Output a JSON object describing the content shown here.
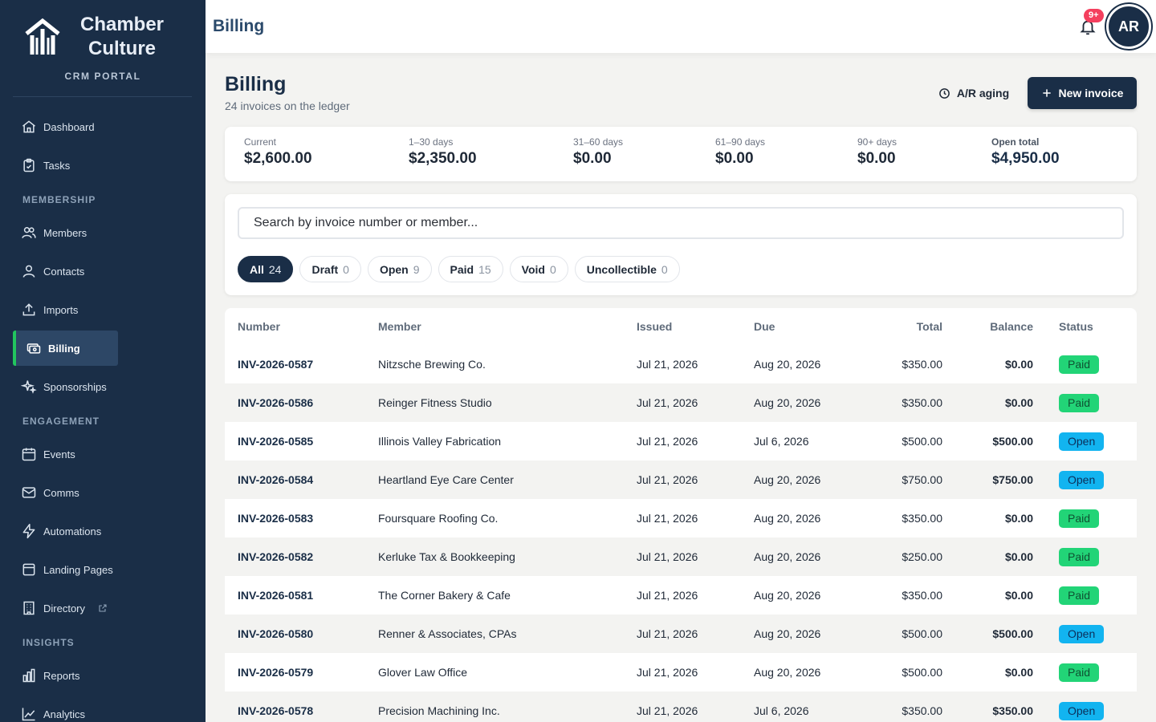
{
  "brand": {
    "name": "Chamber Culture",
    "subtitle": "CRM PORTAL"
  },
  "sidebar": {
    "items": [
      {
        "label": "Dashboard",
        "icon": "home-icon"
      },
      {
        "label": "Tasks",
        "icon": "clipboard-icon"
      },
      {
        "label": "Members",
        "icon": "users-icon"
      },
      {
        "label": "Contacts",
        "icon": "user-icon"
      },
      {
        "label": "Imports",
        "icon": "upload-icon"
      },
      {
        "label": "Billing",
        "icon": "cash-icon",
        "active": true
      },
      {
        "label": "Sponsorships",
        "icon": "sparkles-icon"
      },
      {
        "label": "Events",
        "icon": "calendar-icon"
      },
      {
        "label": "Comms",
        "icon": "mail-icon"
      },
      {
        "label": "Automations",
        "icon": "bolt-icon"
      },
      {
        "label": "Landing Pages",
        "icon": "window-icon"
      },
      {
        "label": "Directory",
        "icon": "building-icon",
        "external": true
      },
      {
        "label": "Reports",
        "icon": "bar-chart-icon"
      },
      {
        "label": "Analytics",
        "icon": "trend-chart-icon"
      }
    ],
    "sections": [
      "MEMBERSHIP",
      "ENGAGEMENT",
      "INSIGHTS"
    ]
  },
  "topbar": {
    "title": "Billing",
    "notification_badge": "9+",
    "avatar_initials": "AR"
  },
  "header": {
    "title": "Billing",
    "subtitle": "24 invoices on the ledger",
    "aging_button": "A/R aging",
    "new_invoice_button": "New invoice"
  },
  "aging": [
    {
      "label": "Current",
      "value": "$2,600.00"
    },
    {
      "label": "1–30 days",
      "value": "$2,350.00"
    },
    {
      "label": "31–60 days",
      "value": "$0.00"
    },
    {
      "label": "61–90 days",
      "value": "$0.00"
    },
    {
      "label": "90+ days",
      "value": "$0.00"
    },
    {
      "label": "Open total",
      "value": "$4,950.00"
    }
  ],
  "search": {
    "placeholder": "Search by invoice number or member..."
  },
  "filters": [
    {
      "label": "All",
      "count": "24",
      "active": true
    },
    {
      "label": "Draft",
      "count": "0"
    },
    {
      "label": "Open",
      "count": "9"
    },
    {
      "label": "Paid",
      "count": "15"
    },
    {
      "label": "Void",
      "count": "0"
    },
    {
      "label": "Uncollectible",
      "count": "0"
    }
  ],
  "table": {
    "columns": [
      "Number",
      "Member",
      "Issued",
      "Due",
      "Total",
      "Balance",
      "Status"
    ],
    "rows": [
      {
        "number": "INV-2026-0587",
        "member": "Nitzsche Brewing Co.",
        "issued": "Jul 21, 2026",
        "due": "Aug 20, 2026",
        "total": "$350.00",
        "balance": "$0.00",
        "status": "Paid"
      },
      {
        "number": "INV-2026-0586",
        "member": "Reinger Fitness Studio",
        "issued": "Jul 21, 2026",
        "due": "Aug 20, 2026",
        "total": "$350.00",
        "balance": "$0.00",
        "status": "Paid"
      },
      {
        "number": "INV-2026-0585",
        "member": "Illinois Valley Fabrication",
        "issued": "Jul 21, 2026",
        "due": "Jul 6, 2026",
        "total": "$500.00",
        "balance": "$500.00",
        "status": "Open"
      },
      {
        "number": "INV-2026-0584",
        "member": "Heartland Eye Care Center",
        "issued": "Jul 21, 2026",
        "due": "Aug 20, 2026",
        "total": "$750.00",
        "balance": "$750.00",
        "status": "Open"
      },
      {
        "number": "INV-2026-0583",
        "member": "Foursquare Roofing Co.",
        "issued": "Jul 21, 2026",
        "due": "Aug 20, 2026",
        "total": "$350.00",
        "balance": "$0.00",
        "status": "Paid"
      },
      {
        "number": "INV-2026-0582",
        "member": "Kerluke Tax & Bookkeeping",
        "issued": "Jul 21, 2026",
        "due": "Aug 20, 2026",
        "total": "$250.00",
        "balance": "$0.00",
        "status": "Paid"
      },
      {
        "number": "INV-2026-0581",
        "member": "The Corner Bakery & Cafe",
        "issued": "Jul 21, 2026",
        "due": "Aug 20, 2026",
        "total": "$350.00",
        "balance": "$0.00",
        "status": "Paid"
      },
      {
        "number": "INV-2026-0580",
        "member": "Renner & Associates, CPAs",
        "issued": "Jul 21, 2026",
        "due": "Aug 20, 2026",
        "total": "$500.00",
        "balance": "$500.00",
        "status": "Open"
      },
      {
        "number": "INV-2026-0579",
        "member": "Glover Law Office",
        "issued": "Jul 21, 2026",
        "due": "Aug 20, 2026",
        "total": "$500.00",
        "balance": "$0.00",
        "status": "Paid"
      },
      {
        "number": "INV-2026-0578",
        "member": "Precision Machining Inc.",
        "issued": "Jul 21, 2026",
        "due": "Jul 6, 2026",
        "total": "$350.00",
        "balance": "$350.00",
        "status": "Open"
      }
    ]
  },
  "colors": {
    "sidebar_bg": "#1a2e47",
    "accent_green": "#22c55e",
    "paid": "#22d477",
    "open": "#12b4f0",
    "badge": "#f43f5e"
  }
}
